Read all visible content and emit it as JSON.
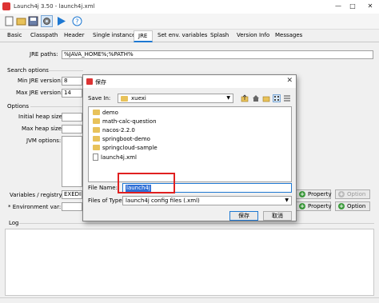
{
  "window": {
    "title": "Launch4j 3.50 - launch4j.xml",
    "controls": [
      "—",
      "□",
      "✕"
    ]
  },
  "tabs": [
    "Basic",
    "Classpath",
    "Header",
    "Single instance",
    "JRE",
    "Set env. variables",
    "Splash",
    "Version Info",
    "Messages"
  ],
  "active_tab": "JRE",
  "form": {
    "jre_paths_label": "JRE paths:",
    "jre_paths_value": "%JAVA_HOME%;%PATH%",
    "search_options_heading": "Search options",
    "min_jre_label": "Min JRE version:",
    "min_jre_value": "8",
    "max_jre_label": "Max JRE version:",
    "max_jre_value": "14",
    "options_heading": "Options",
    "initial_heap_label": "Initial heap size:",
    "max_heap_label": "Max heap size:",
    "jvm_options_label": "JVM options:",
    "vars_registry_label": "Variables / registry:",
    "vars_registry_value": "EXEDIR",
    "env_var_label": "* Environment var:"
  },
  "right_buttons": {
    "property_label": "Property",
    "option_label": "Option"
  },
  "log_heading": "Log",
  "dialog": {
    "title": "保存",
    "save_in_label": "Save In:",
    "save_in_value": "xuexi",
    "files": [
      {
        "name": "demo",
        "kind": "folder"
      },
      {
        "name": "math-calc-question",
        "kind": "folder"
      },
      {
        "name": "nacos-2.2.0",
        "kind": "folder"
      },
      {
        "name": "springboot-demo",
        "kind": "folder"
      },
      {
        "name": "springcloud-sample",
        "kind": "folder"
      },
      {
        "name": "launch4j.xml",
        "kind": "file"
      }
    ],
    "file_name_label": "File Name:",
    "file_name_value": "launch4j",
    "files_of_type_label": "Files of Type:",
    "files_of_type_value": "launch4j config files (.xml)",
    "save_button": "保存",
    "cancel_button": "取消"
  }
}
